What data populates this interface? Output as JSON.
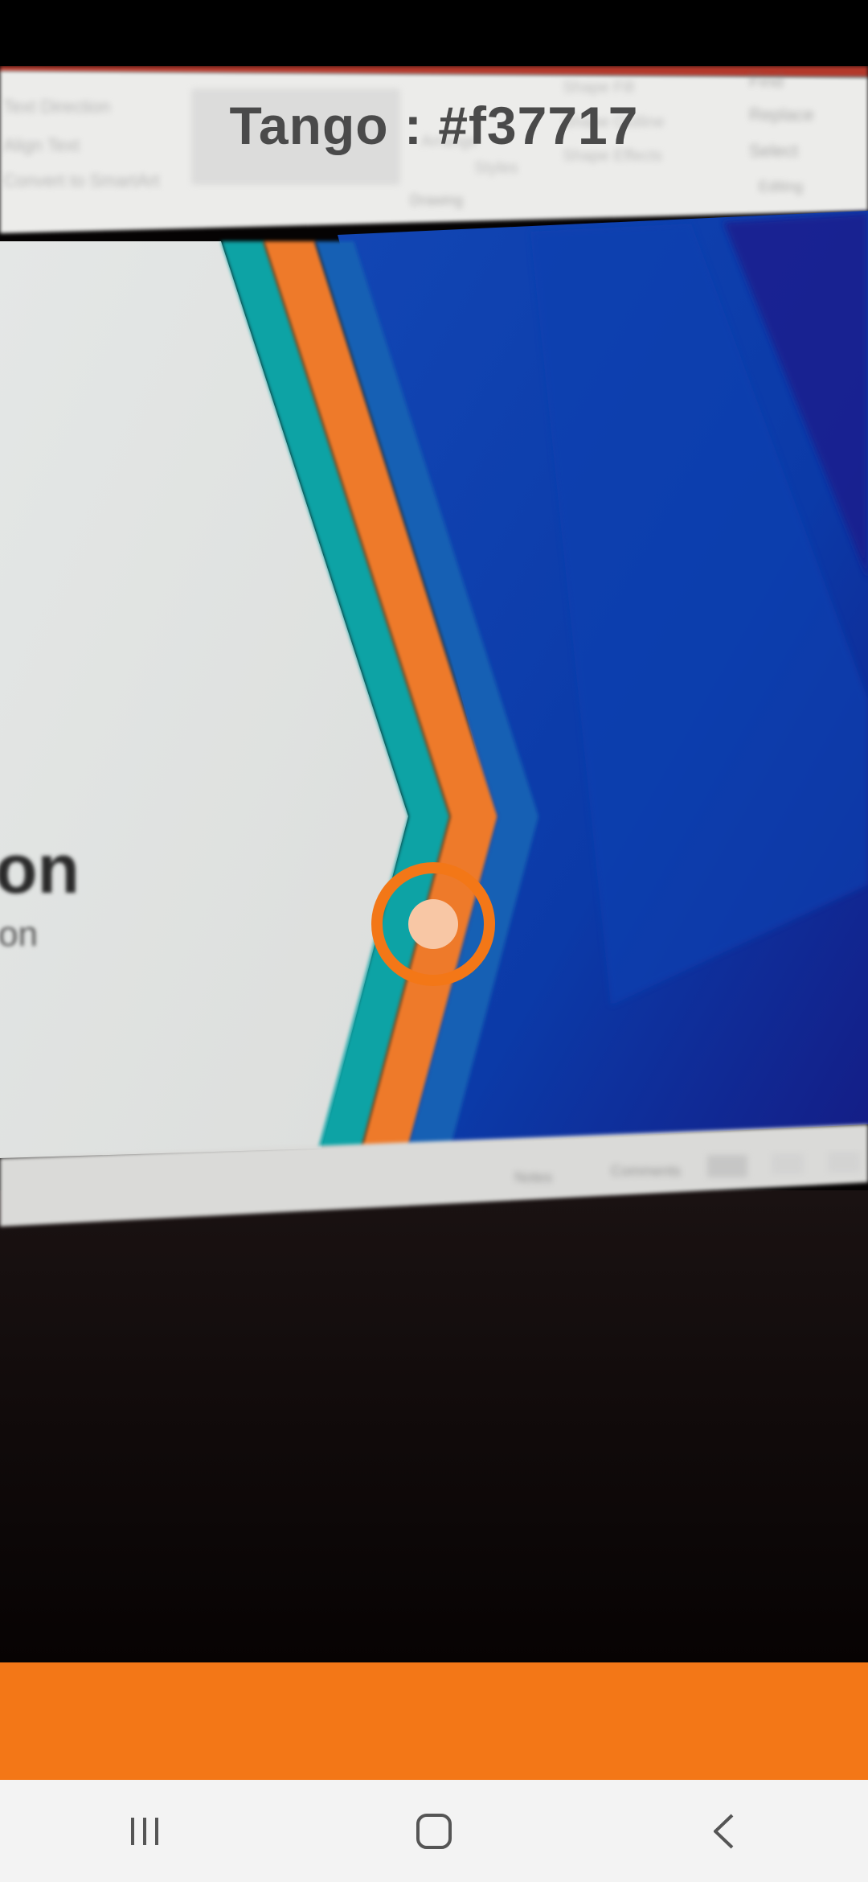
{
  "readout": {
    "color_name": "Tango",
    "separator": " : ",
    "hex_value": "#f37717"
  },
  "colors": {
    "detected": "#f37717",
    "reticle_ring": "#f37717",
    "reticle_center": "#f8c7a5",
    "nav_bar_bg": "#f3f3f3",
    "readout_text": "#4a4a4a"
  },
  "background_screen": {
    "ribbon_items": [
      "Find",
      "Replace",
      "Select",
      "Editing",
      "Drawing",
      "Shape Fill",
      "Shape Outline",
      "Shape Effects",
      "Styles",
      "Arrange",
      "Text Direction",
      "Align Text",
      "Convert to SmartArt"
    ],
    "slide_title_fragment": "on",
    "slide_subtitle_fragment": "on",
    "status_items": [
      "Notes",
      "Comments"
    ]
  },
  "nav": {
    "recents_icon": "recents-icon",
    "home_icon": "home-icon",
    "back_icon": "back-icon"
  }
}
